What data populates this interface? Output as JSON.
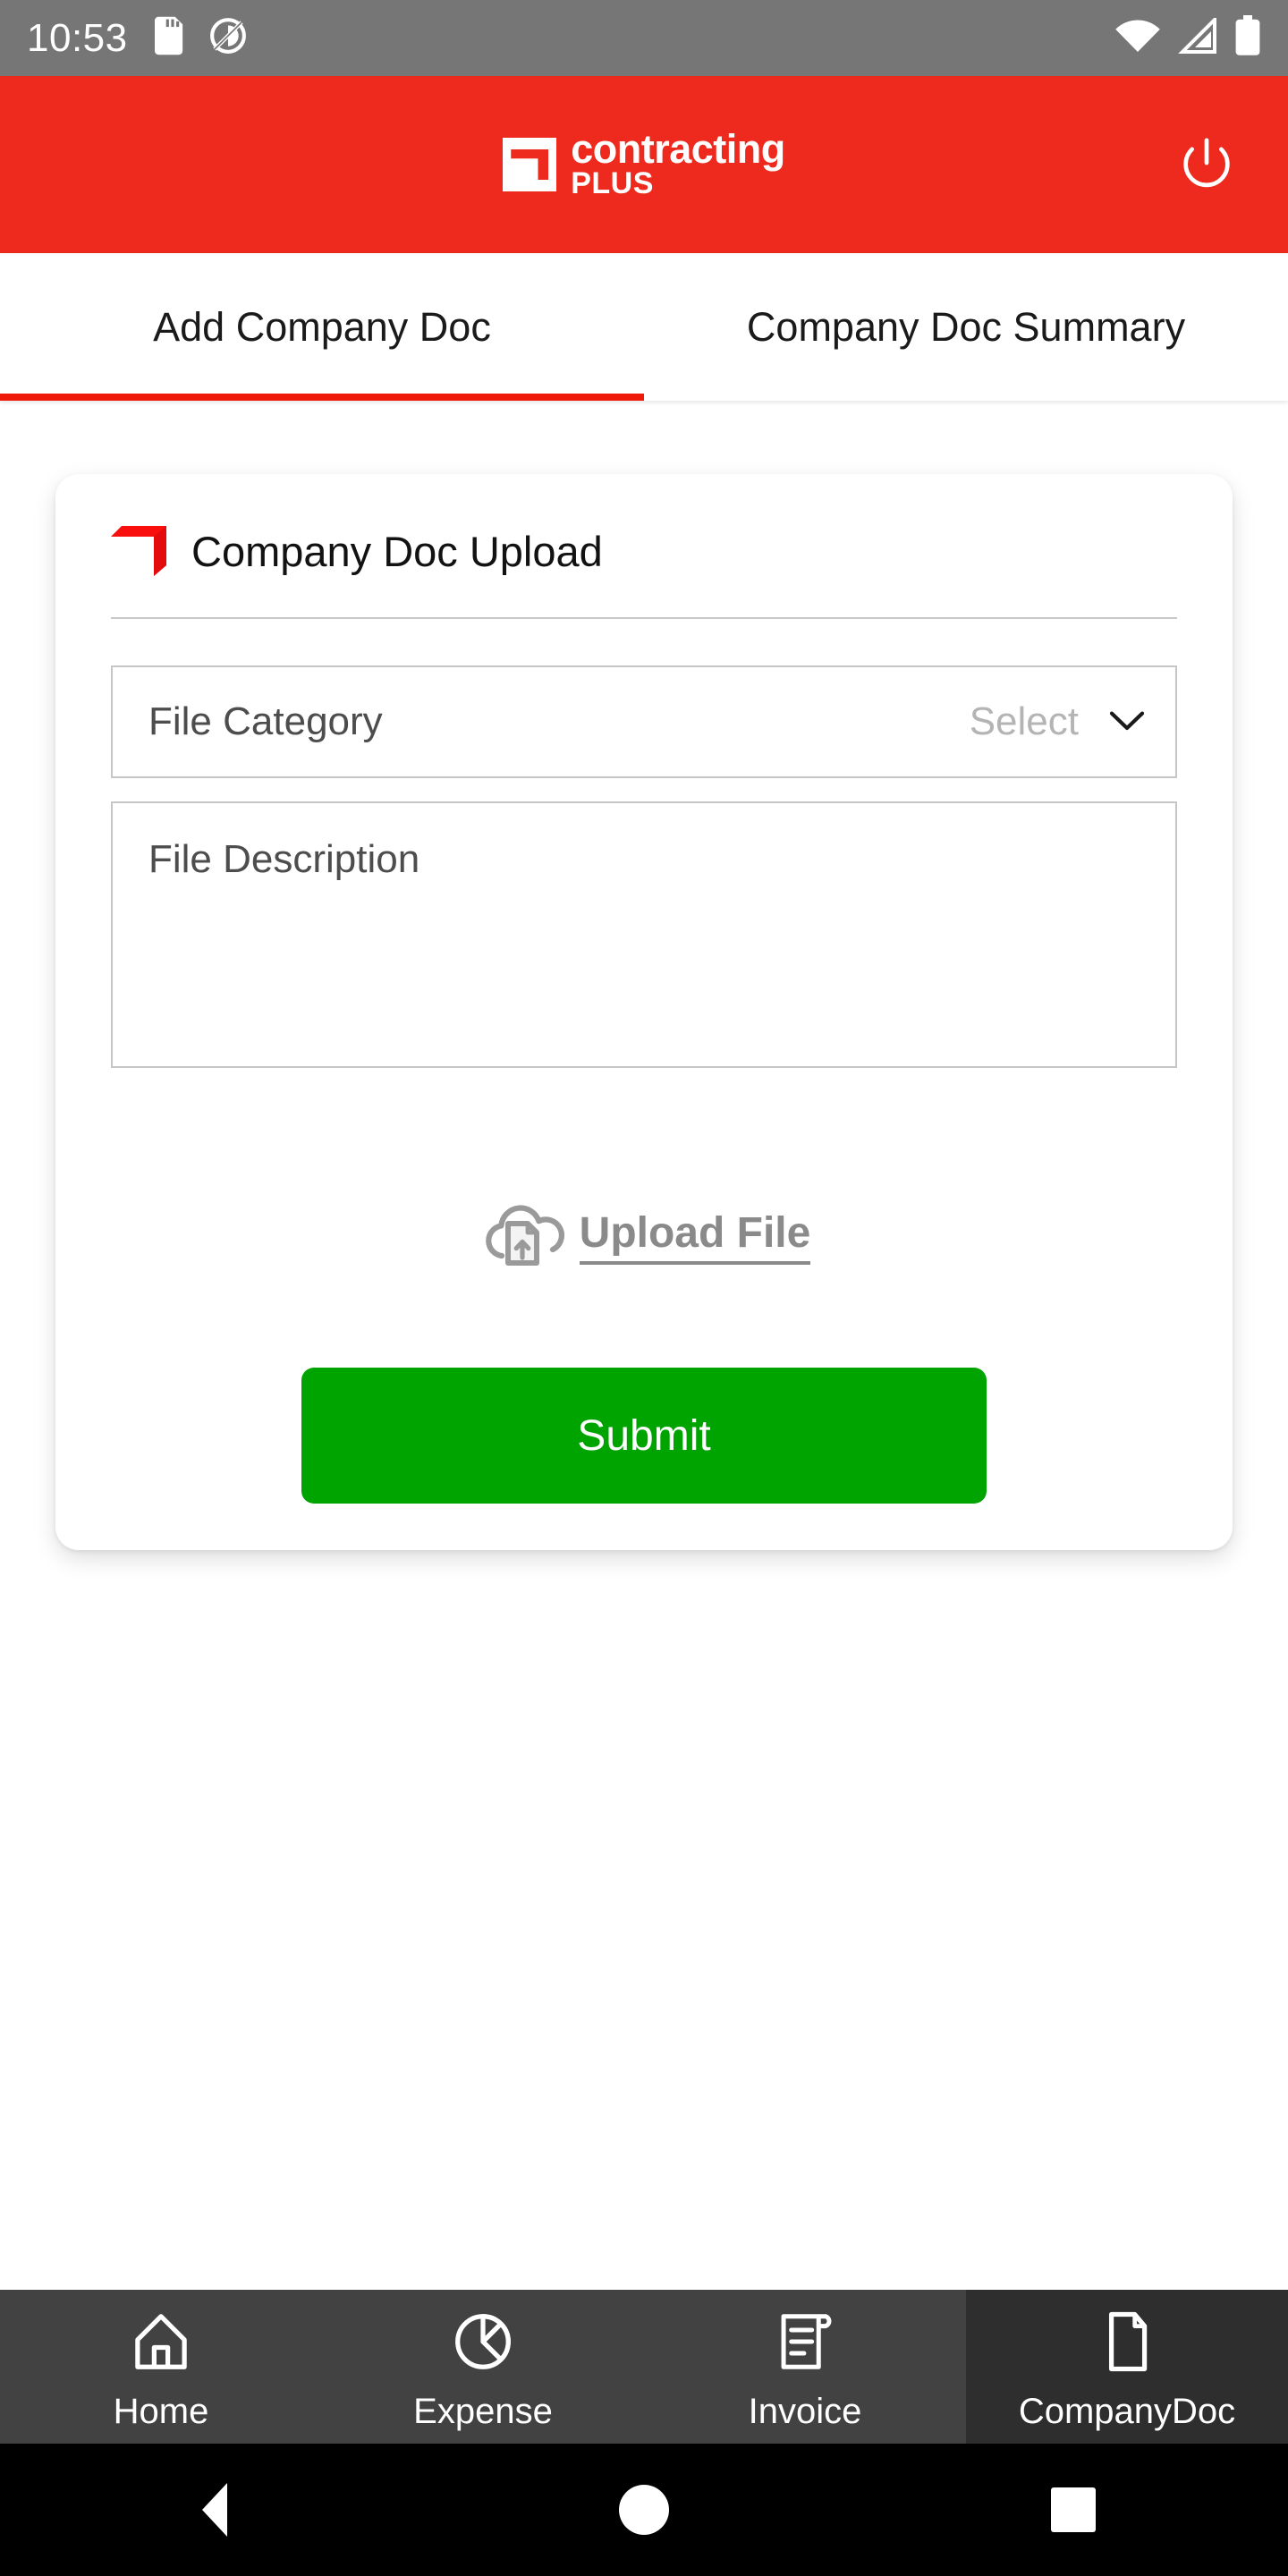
{
  "status_bar": {
    "time": "10:53",
    "icons_left": [
      "sd-card-icon",
      "do-not-disturb-icon"
    ],
    "icons_right": [
      "wifi-icon",
      "cell-signal-icon",
      "battery-icon"
    ],
    "background_color": "#767676"
  },
  "header": {
    "brand_line1": "contracting",
    "brand_line2": "PLUS",
    "logo_name": "contracting-plus-logo",
    "power_icon": "power-icon",
    "background_color": "#ee2a1e"
  },
  "tabs": {
    "active_index": 0,
    "indicator_color": "#f01a0b",
    "items": [
      {
        "label": "Add Company Doc"
      },
      {
        "label": "Company Doc Summary"
      }
    ]
  },
  "card": {
    "title": "Company Doc Upload",
    "logo_name": "contracting-plus-mark",
    "file_category": {
      "label": "File Category",
      "value": "Select",
      "chevron_icon": "chevron-down-icon"
    },
    "file_description": {
      "placeholder": "File Description",
      "value": ""
    },
    "upload": {
      "label": "Upload File",
      "icon": "cloud-upload-icon"
    },
    "submit": {
      "label": "Submit",
      "color": "#00a400"
    }
  },
  "bottom_nav": {
    "active_index": 3,
    "background_color": "#424242",
    "active_background_color": "#2e2e2e",
    "items": [
      {
        "label": "Home",
        "icon": "home-icon"
      },
      {
        "label": "Expense",
        "icon": "pie-chart-icon"
      },
      {
        "label": "Invoice",
        "icon": "receipt-icon"
      },
      {
        "label": "CompanyDoc",
        "icon": "document-icon"
      }
    ]
  },
  "android_nav": {
    "back": "back-triangle-icon",
    "home": "home-circle-icon",
    "recents": "recents-square-icon"
  }
}
